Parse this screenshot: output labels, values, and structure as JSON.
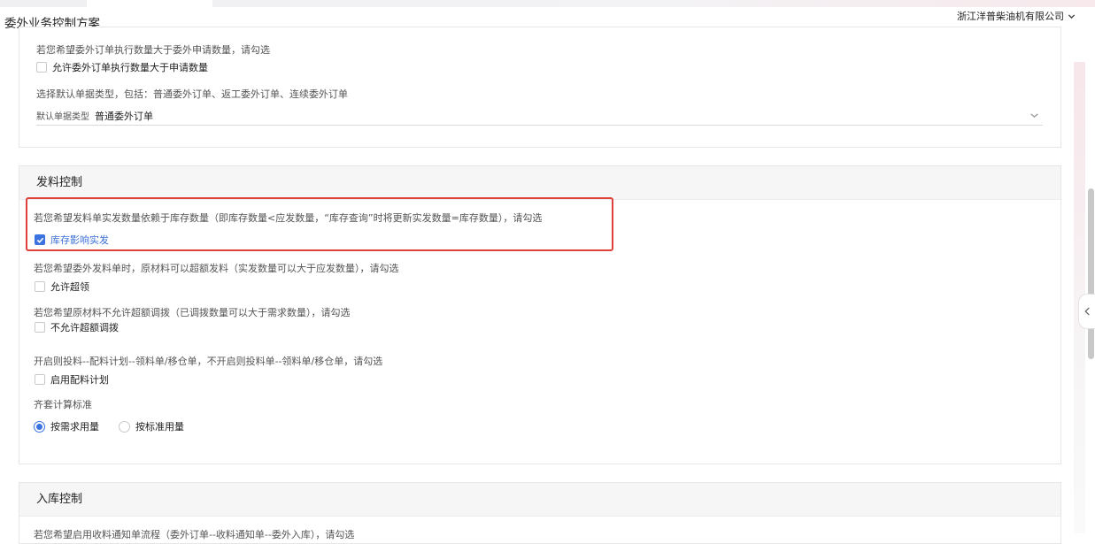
{
  "header": {
    "title": "委外业务控制方案",
    "company": "浙江洋普柴油机有限公司"
  },
  "section_general": {
    "hint_exec_qty": "若您希望委外订单执行数量大于委外申请数量，请勾选",
    "allow_exec_qty_label": "允许委外订单执行数量大于申请数量",
    "hint_doc_type": "选择默认单据类型，包括：普通委外订单、返工委外订单、连续委外订单",
    "doc_type_label": "默认单据类型",
    "doc_type_value": "普通委外订单"
  },
  "section_issue": {
    "title": "发料控制",
    "hint_inventory": "若您希望发料单实发数量依赖于库存数量（即库存数量<应发数量，“库存查询”时将更新实发数量=库存数量），请勾选",
    "inventory_label": "库存影响实发",
    "hint_overissue": "若您希望委外发料单时，原材料可以超额发料（实发数量可以大于应发数量），请勾选",
    "overissue_label": "允许超领",
    "hint_overtransfer": "若您希望原材料不允许超额调拨（已调拨数量可以大于需求数量），请勾选",
    "overtransfer_label": "不允许超额调拨",
    "hint_plan": "开启则投料--配料计划--领料单/移仓单，不开启则投料单--领料单/移仓单，请勾选",
    "plan_label": "启用配料计划",
    "kit_title": "齐套计算标准",
    "radio_demand": "按需求用量",
    "radio_standard": "按标准用量"
  },
  "section_receipt": {
    "title": "入库控制",
    "hint_partial": "若您希望启用收料通知单流程（委外订单--收料通知单--委外入库），请勾选"
  },
  "state": {
    "allow_exec_qty_checked": false,
    "inventory_checked": true,
    "overissue_checked": false,
    "overtransfer_checked": false,
    "plan_checked": false,
    "kit_selected": "demand"
  },
  "colors": {
    "accent": "#3b73e0",
    "highlight": "#e0403a"
  }
}
